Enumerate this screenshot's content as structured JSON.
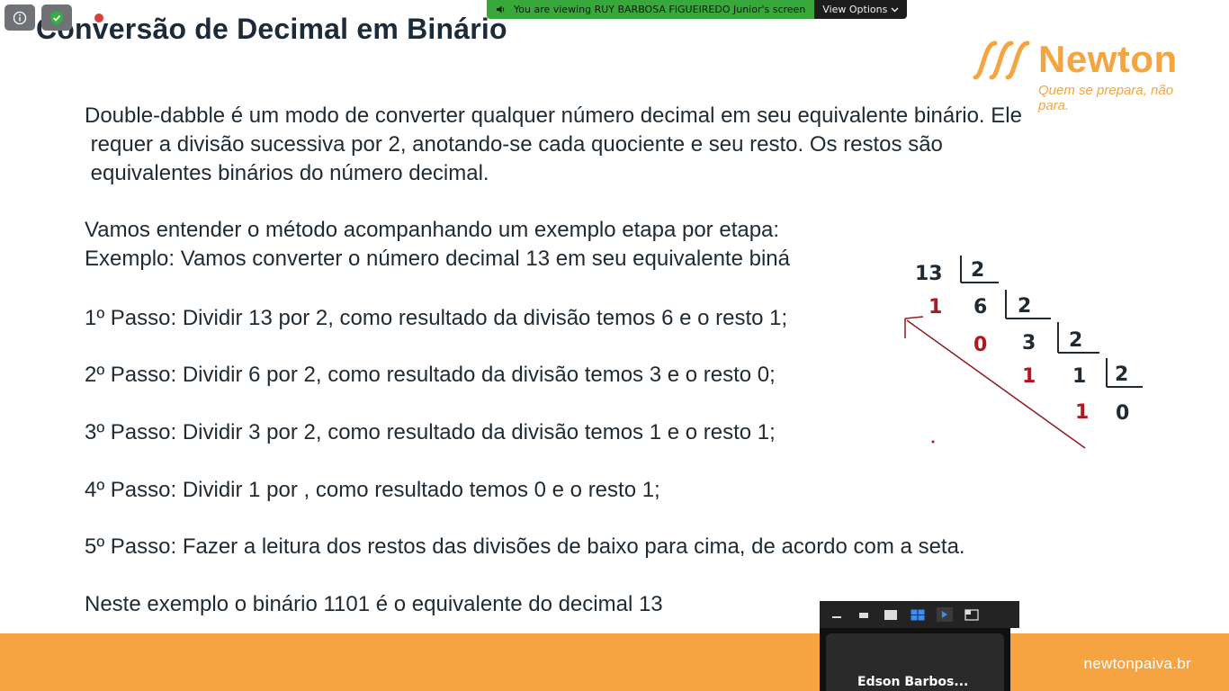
{
  "slide": {
    "title": "Conversão de Decimal em Binário",
    "logo_word": "Newton",
    "logo_tagline": "Quem se prepara, não para.",
    "footer_url": "newtonpaiva.br",
    "accent_color": "#f6a441",
    "paragraph1": [
      "Double-dabble é um modo de converter qualquer número decimal em seu equivalente binário. Ele",
      " requer a divisão sucessiva por 2, anotando-se cada quociente e seu resto. Os restos são",
      " equivalentes binários do número decimal."
    ],
    "intro_line": "Vamos entender o método acompanhando um exemplo etapa por etapa:",
    "example_line": "Exemplo: Vamos converter o número decimal 13 em seu equivalente biná",
    "steps": [
      "1º Passo: Dividir 13 por 2, como resultado da divisão temos 6 e o resto 1;",
      "2º Passo: Dividir 6 por 2, como resultado da divisão temos 3 e o resto 0;",
      "3º Passo: Dividir 3 por 2, como resultado da divisão temos 1 e o resto 1;",
      "4º Passo: Dividir 1 por , como resultado temos 0 e o resto 1;",
      "5º Passo: Fazer a leitura dos restos das divisões de baixo para cima, de acordo com a seta."
    ],
    "conclusion": "Neste exemplo o binário 1101 é o equivalente do decimal 13",
    "diagram": {
      "dividends": [
        "13",
        "6",
        "3",
        "1",
        "0"
      ],
      "divisors": [
        "2",
        "2",
        "2",
        "2"
      ],
      "remainders": [
        "1",
        "0",
        "1",
        "1"
      ],
      "remainder_color": "#b3161c"
    }
  },
  "zoom": {
    "banner_text": "You are viewing RUY BARBOSA FIGUEIREDO Junior's screen",
    "view_options_label": "View Options",
    "participant_name": "Edson Barbos...",
    "icons": [
      "info-icon",
      "shield-check-icon",
      "speaker-icon",
      "chevron-down-icon",
      "minimize-icon",
      "restore-icon",
      "square-icon",
      "gallery-grid-icon",
      "arrow-right-icon",
      "layout-icon"
    ]
  }
}
